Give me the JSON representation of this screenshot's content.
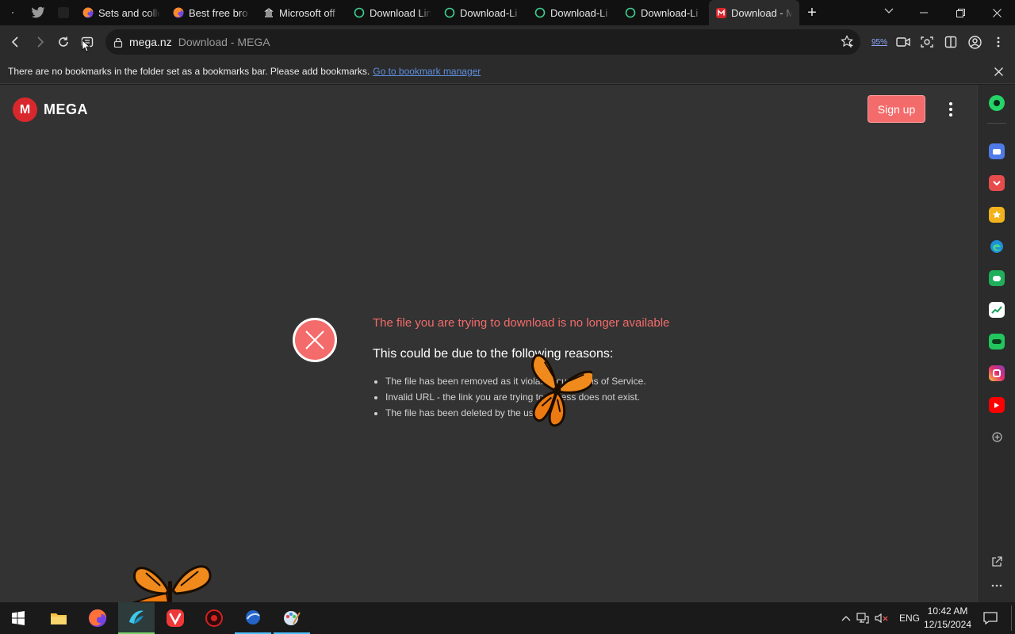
{
  "browser": {
    "tabs": [
      {
        "label": "Sets and colle",
        "icon": "firefox-icon"
      },
      {
        "label": "Best free bro",
        "icon": "firefox-icon"
      },
      {
        "label": "Microsoft off",
        "icon": "building-icon"
      },
      {
        "label": "Download Lin",
        "icon": "globe-ring-icon"
      },
      {
        "label": "Download-Li",
        "icon": "globe-ring-icon"
      },
      {
        "label": "Download-Li",
        "icon": "globe-ring-icon"
      },
      {
        "label": "Download-Li",
        "icon": "globe-ring-icon"
      },
      {
        "label": "Download - M",
        "icon": "mega-icon",
        "active": true
      }
    ],
    "new_tab_label": "+",
    "address": {
      "host": "mega.nz",
      "page_title": "Download - MEGA"
    },
    "zoom": "95%",
    "bookmarks_bar": {
      "message": "There are no bookmarks in the folder set as a bookmarks bar. Please add bookmarks.",
      "link": "Go to bookmark manager"
    }
  },
  "page": {
    "logo_letter": "M",
    "logo_text": "MEGA",
    "signup_label": "Sign up",
    "error": {
      "title": "The file you are trying to download is no longer available",
      "subtitle": "This could be due to the following reasons:",
      "reasons": [
        "The file has been removed as it violated our Terms of Service.",
        "Invalid URL - the link you are trying to access does not exist.",
        "The file has been deleted by the user."
      ]
    }
  },
  "taskbar": {
    "language": "ENG",
    "time": "10:42 AM",
    "date": "12/15/2024"
  },
  "colors": {
    "accent_red": "#f46b6b",
    "mega_red": "#d9272e",
    "link_blue": "#5f8fe0"
  }
}
